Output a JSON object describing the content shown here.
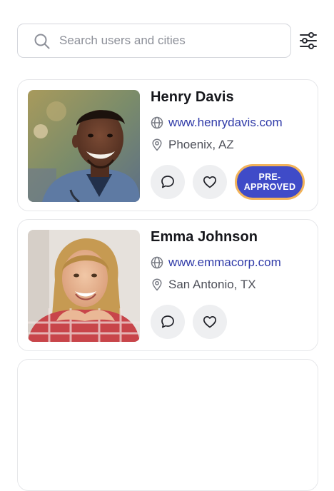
{
  "search": {
    "placeholder": "Search users and cities",
    "value": "",
    "icon": "search-icon",
    "filter_icon": "sliders-icon"
  },
  "users": [
    {
      "name": "Henry Davis",
      "website": "www.henrydavis.com",
      "location": "Phoenix, AZ",
      "badge": "PRE-\nAPPROVED",
      "photo": "portrait-smiling-man-in-scrubs"
    },
    {
      "name": "Emma Johnson",
      "website": "www.emmacorp.com",
      "location": "San Antonio, TX",
      "photo": "portrait-smiling-woman-chin-on-hands"
    }
  ],
  "colors": {
    "link": "#2f3aa8",
    "badge_bg": "#3f4bc8",
    "badge_border": "#f2b35a",
    "action_bg": "#eeeff1",
    "card_border": "#e6e7ea"
  }
}
